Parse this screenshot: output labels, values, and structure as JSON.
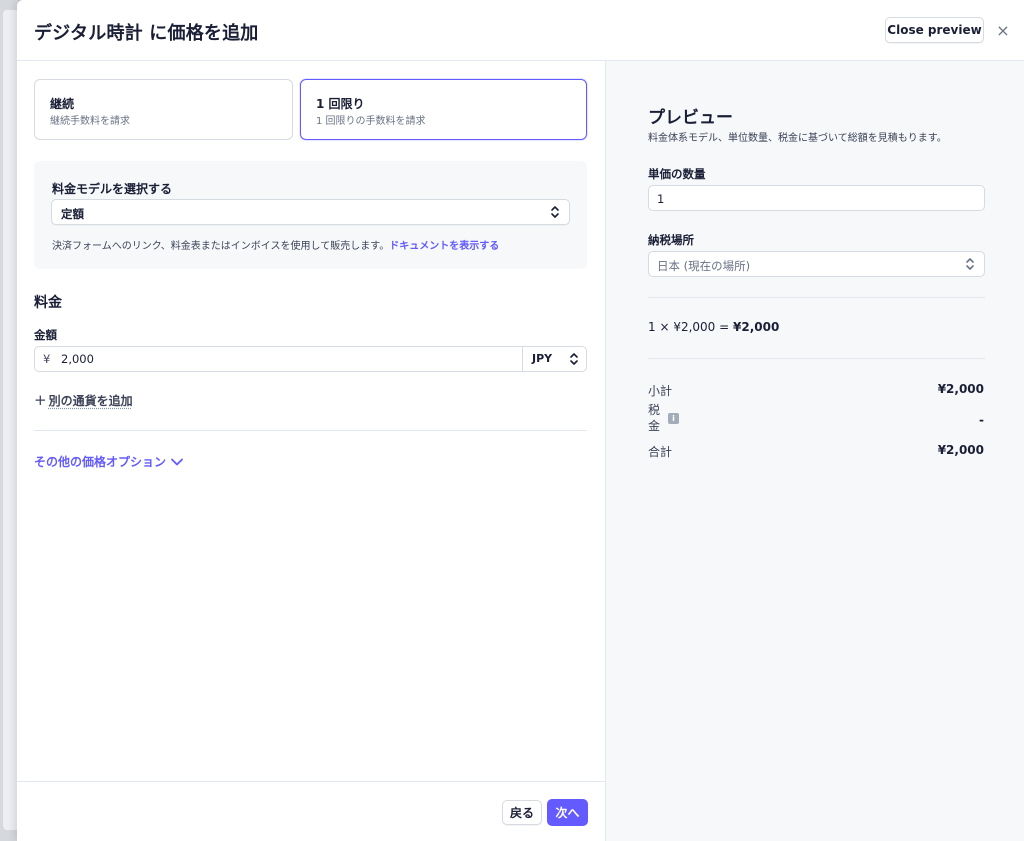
{
  "header": {
    "title": "デジタル時計 に価格を追加",
    "close_preview_label": "Close preview",
    "close_icon": "×"
  },
  "billing_type": {
    "options": [
      {
        "title": "継続",
        "subtitle": "継続手数料を請求",
        "selected": false
      },
      {
        "title": "1 回限り",
        "subtitle": "1 回限りの手数料を請求",
        "selected": true
      }
    ]
  },
  "pricing_model": {
    "label": "料金モデルを選択する",
    "selected": "定額",
    "description": "決済フォームへのリンク、料金表またはインボイスを使用して販売します。",
    "doc_link": "ドキュメントを表示する"
  },
  "price": {
    "section_title": "料金",
    "amount_label": "金額",
    "currency_symbol": "¥",
    "amount_value": "2,000",
    "currency_code": "JPY",
    "add_currency_label": "別の通貨を追加",
    "add_currency_plus": "+",
    "more_options_label": "その他の価格オプション"
  },
  "footer": {
    "back_label": "戻る",
    "next_label": "次へ"
  },
  "preview": {
    "title": "プレビュー",
    "subtitle": "料金体系モデル、単位数量、税金に基づいて総額を見積もります。",
    "quantity_label": "単価の数量",
    "quantity_value": "1",
    "tax_location_label": "納税場所",
    "tax_location_value": "日本 (現在の場所)",
    "calc_prefix": "1 × ¥2,000 = ",
    "calc_total": "¥2,000",
    "subtotal_label": "小計",
    "subtotal_value": "¥2,000",
    "tax_label": "税金",
    "tax_value": "-",
    "total_label": "合計",
    "total_value": "¥2,000"
  },
  "colors": {
    "accent": "#635bff",
    "text": "#1a1f36",
    "muted": "#697386",
    "border": "#d5dbe1",
    "panel_bg": "#f6f8fa"
  },
  "icons": {
    "close": "close-icon",
    "chevron_updown": "chevron-updown-icon",
    "chevron_down": "chevron-down-icon",
    "plus": "plus-icon",
    "info": "info-icon"
  }
}
